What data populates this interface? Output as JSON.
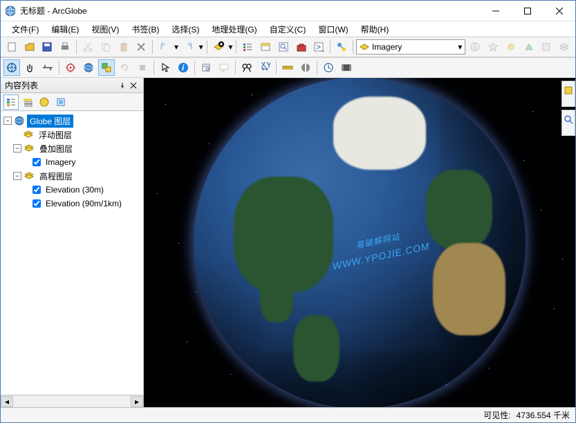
{
  "window": {
    "title": "无标题 - ArcGlobe"
  },
  "menu": {
    "file": "文件(F)",
    "edit": "编辑(E)",
    "view": "视图(V)",
    "bookmarks": "书签(B)",
    "selection": "选择(S)",
    "geoprocessing": "地理处理(G)",
    "customize": "自定义(C)",
    "window": "窗口(W)",
    "help": "帮助(H)"
  },
  "toolbar": {
    "imagery_selected": "Imagery"
  },
  "toc": {
    "title": "内容列表",
    "tree": {
      "root": "Globe 图层",
      "floating": "浮动图层",
      "draped": "叠加图层",
      "imagery": "Imagery",
      "elevation_group": "高程图层",
      "elev30": "Elevation (30m)",
      "elev90": "Elevation (90m/1km)"
    }
  },
  "watermark": {
    "line1": "易破解网站",
    "line2": "WWW.YPOJIE.COM"
  },
  "sidetools": {
    "catalog": "目录",
    "search": "搜索"
  },
  "status": {
    "visibility_label": "可见性:",
    "visibility_value": "4736.554 千米"
  }
}
